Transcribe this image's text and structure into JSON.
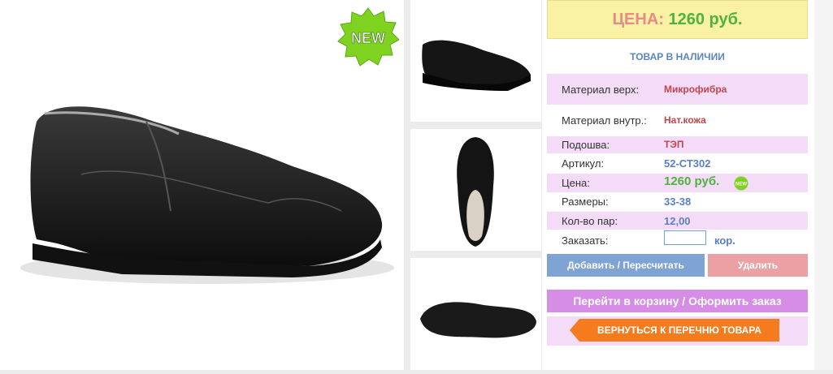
{
  "badge": {
    "main": "NEW",
    "mini": "NEW"
  },
  "price_header": {
    "label": "ЦЕНА:",
    "value": "1260 руб."
  },
  "stock_status": "ТОВАР В НАЛИЧИИ",
  "specs": [
    {
      "label": "Материал верх:",
      "value": "Микрофибра"
    },
    {
      "label": "Материал внутр.:",
      "value": "Нат.кожа"
    },
    {
      "label": "Подошва:",
      "value": "ТЭП"
    },
    {
      "label": "Артикул:",
      "value": "52-СТ302"
    },
    {
      "label": "Цена:",
      "value": "1260 руб."
    },
    {
      "label": "Размеры:",
      "value": "33-38"
    },
    {
      "label": "Кол-во пар:",
      "value": "12,00"
    }
  ],
  "order": {
    "label": "Заказать:",
    "value": "",
    "unit": "кор."
  },
  "buttons": {
    "add": "Добавить / Пересчитать",
    "delete": "Удалить",
    "cart": "Перейти в корзину / Оформить заказ",
    "back": "ВЕРНУТЬСЯ К ПЕРЕЧНЮ ТОВАРА"
  },
  "colors": {
    "price_bg": "#f9f2a5",
    "row_pink": "#f4dbf8",
    "accent_green": "#4eb33e",
    "accent_orange": "#f47c1f",
    "button_blue": "#7ea3d4",
    "button_pink": "#eba1a3",
    "button_purple": "#d58de6"
  },
  "icons": [
    "new-badge-icon",
    "mini-new-badge-icon"
  ]
}
